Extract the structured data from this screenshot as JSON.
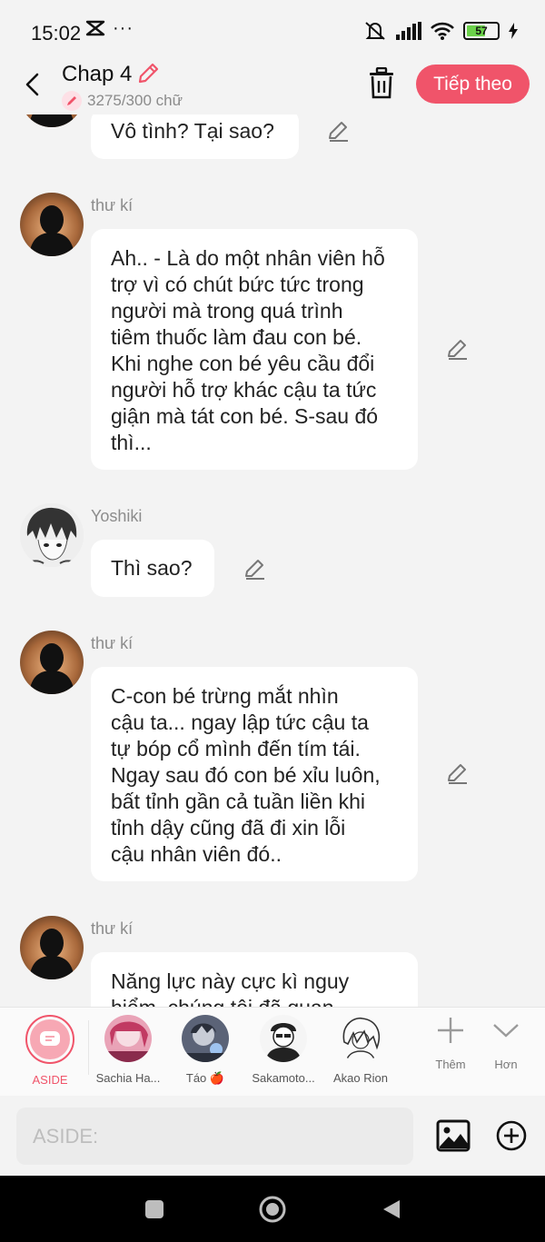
{
  "status_bar": {
    "time": "15:02",
    "battery": "57"
  },
  "header": {
    "title": "Chap 4",
    "word_count": "3275/300 chữ",
    "next_label": "Tiếp theo"
  },
  "messages": [
    {
      "sender": "",
      "avatar": "silhouette-avatar",
      "lines": [
        "Vô tình? Tại sao?"
      ]
    },
    {
      "sender": "thư kí",
      "avatar": "silhouette-avatar",
      "lines": [
        "Ah.. - Là do một nhân viên hỗ",
        "trợ vì có chút bức tức trong",
        "người mà trong quá trình",
        "tiêm thuốc làm đau con bé.",
        "Khi nghe con bé yêu cầu đổi",
        "người hỗ trợ khác cậu ta tức",
        "giận mà tát con bé. S-sau đó",
        "thì..."
      ]
    },
    {
      "sender": "Yoshiki",
      "avatar": "anime-avatar",
      "lines": [
        "Thì sao?"
      ]
    },
    {
      "sender": "thư kí",
      "avatar": "silhouette-avatar",
      "lines": [
        "C-con bé trừng mắt nhìn",
        "cậu ta... ngay lập tức cậu ta",
        "tự bóp cổ mình đến tím tái.",
        "Ngay sau đó con bé xỉu luôn,",
        "bất tỉnh gần cả tuần liền khi",
        "tỉnh dậy cũng đã đi xin lỗi",
        "cậu nhân viên đó.."
      ]
    },
    {
      "sender": "thư kí",
      "avatar": "silhouette-avatar",
      "lines": [
        "Năng lực này cực kì nguy",
        "hiểm, chúng tôi đã quan"
      ]
    }
  ],
  "characters": [
    {
      "name": "ASIDE",
      "selected": true
    },
    {
      "name": "Sachia Ha...",
      "selected": false
    },
    {
      "name": "Táo 🍎",
      "selected": false
    },
    {
      "name": "Sakamoto...",
      "selected": false
    },
    {
      "name": "Akao Rion",
      "selected": false
    }
  ],
  "tools": {
    "add_label": "Thêm",
    "more_label": "Hơn"
  },
  "input": {
    "placeholder": "ASIDE:"
  },
  "colors": {
    "accent": "#f0546a",
    "bubble": "#ffffff",
    "background": "#f3f3f3"
  }
}
